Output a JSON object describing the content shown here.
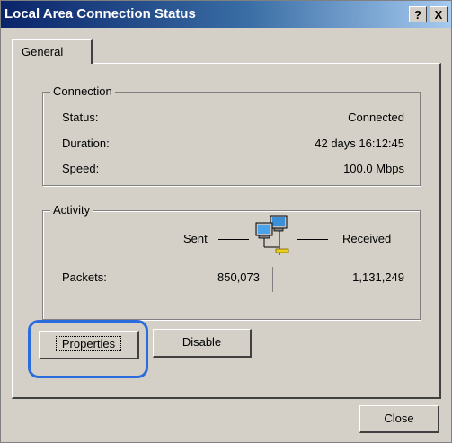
{
  "window": {
    "title": "Local Area Connection Status",
    "help_label": "?",
    "close_label": "X"
  },
  "tabs": [
    {
      "label": "General",
      "active": true
    }
  ],
  "connection": {
    "legend": "Connection",
    "rows": [
      {
        "label": "Status:",
        "value": "Connected"
      },
      {
        "label": "Duration:",
        "value": "42 days 16:12:45"
      },
      {
        "label": "Speed:",
        "value": "100.0 Mbps"
      }
    ]
  },
  "activity": {
    "legend": "Activity",
    "sent_label": "Sent",
    "received_label": "Received",
    "packets_label": "Packets:",
    "packets_sent": "850,073",
    "packets_received": "1,131,249",
    "icon": "network-computers-icon"
  },
  "buttons": {
    "properties": {
      "label": "Properties"
    },
    "disable": {
      "label": "Disable"
    },
    "close": {
      "label": "Close"
    }
  },
  "colors": {
    "face": "#d4d0c8",
    "titlebar_start": "#0a246a",
    "titlebar_end": "#a6caf0",
    "highlight": "#2a6bde"
  }
}
